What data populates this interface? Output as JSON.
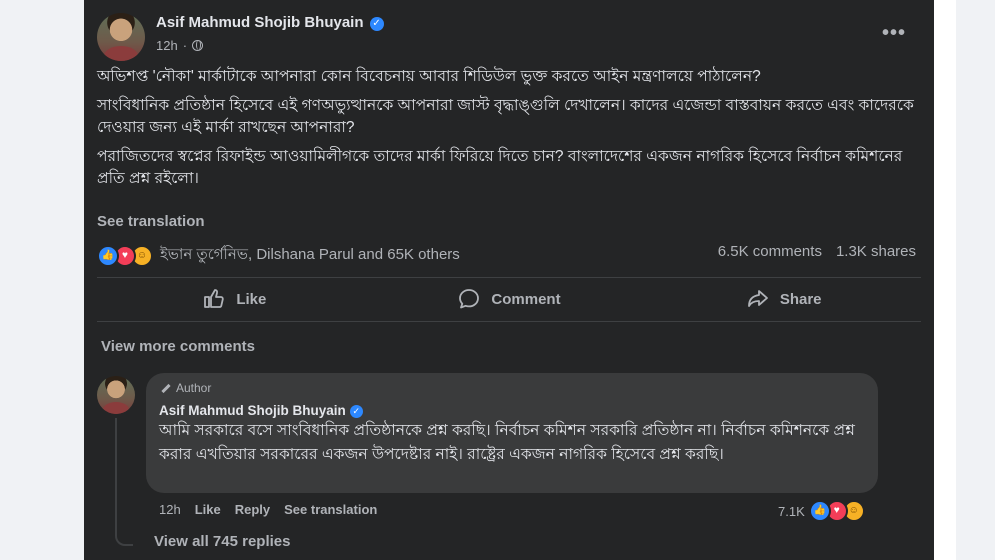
{
  "post": {
    "author": "Asif Mahmud Shojib Bhuyain",
    "time": "12h",
    "paragraphs": [
      "অভিশপ্ত 'নৌকা' মার্কাটাকে আপনারা কোন বিবেচনায় আবার শিডিউল ভুক্ত করতে আইন মন্ত্রণালয়ে পাঠালেন?",
      "সাংবিধানিক প্রতিষ্ঠান হিসেবে এই গণঅভ্যুত্থানকে আপনারা জাস্ট বৃদ্ধাঙ্গুলি দেখালেন। কাদের এজেন্ডা বাস্তবায়ন করতে এবং কাদেরকে দেওয়ার জন্য এই মার্কা রাখছেন আপনারা?",
      "পরাজিতদের স্বপ্নের রিফাইন্ড আওয়ামিলীগকে তাদের মার্কা ফিরিয়ে দিতে চান? বাংলাদেশের একজন নাগরিক হিসেবে নির্বাচন কমিশনের প্রতি প্রশ্ন রইলো।"
    ],
    "see_translation": "See translation",
    "reactions_text": "ইভান তুর্গেনিভ, Dilshana Parul and 65K others",
    "comments_count": "6.5K comments",
    "shares_count": "1.3K shares"
  },
  "actions": {
    "like": "Like",
    "comment": "Comment",
    "share": "Share"
  },
  "view_more_comments": "View more comments",
  "comment": {
    "badge": "Author",
    "author": "Asif Mahmud Shojib Bhuyain",
    "text": "আমি সরকারে বসে সাংবিধানিক প্রতিষ্ঠানকে প্রশ্ন করছি। নির্বাচন কমিশন সরকারি প্রতিষ্ঠান না। নির্বাচন কমিশনকে প্রশ্ন করার এখতিয়ার সরকারের একজন উপদেষ্টার নাই। রাষ্ট্রের একজন নাগরিক হিসেবে প্রশ্ন করছি।",
    "time": "12h",
    "like": "Like",
    "reply": "Reply",
    "see_translation": "See translation",
    "reaction_count": "7.1K",
    "view_all_replies": "View all 745 replies"
  },
  "colors": {
    "card_bg": "#242526",
    "bubble_bg": "#3a3b3c",
    "primary_text": "#e4e6eb",
    "secondary_text": "#b0b3b8",
    "verified": "#2d88ff"
  },
  "icons": [
    "verified-badge-icon",
    "globe-icon",
    "more-options-icon",
    "like-reaction-icon",
    "love-reaction-icon",
    "haha-reaction-icon",
    "thumbs-up-icon",
    "comment-bubble-icon",
    "share-arrow-icon",
    "pencil-icon"
  ]
}
